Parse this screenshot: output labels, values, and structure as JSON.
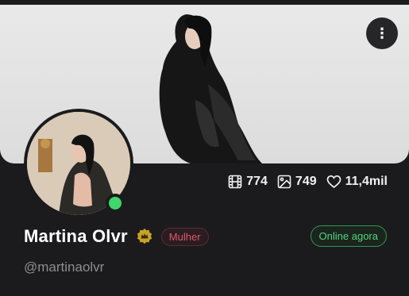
{
  "profile": {
    "name": "Martina Olvr",
    "handle": "@martinaolvr",
    "gender_tag": "Mulher",
    "status": "Online agora"
  },
  "stats": {
    "videos": "774",
    "photos": "749",
    "likes": "11,4mil"
  },
  "menu": {
    "icon": "more-vertical-icon"
  },
  "colors": {
    "background": "#1b1b1d",
    "online": "#3fd66b",
    "gender_tag": "#e4556a",
    "status": "#52d67e",
    "verified_badge": "#c9a227"
  }
}
